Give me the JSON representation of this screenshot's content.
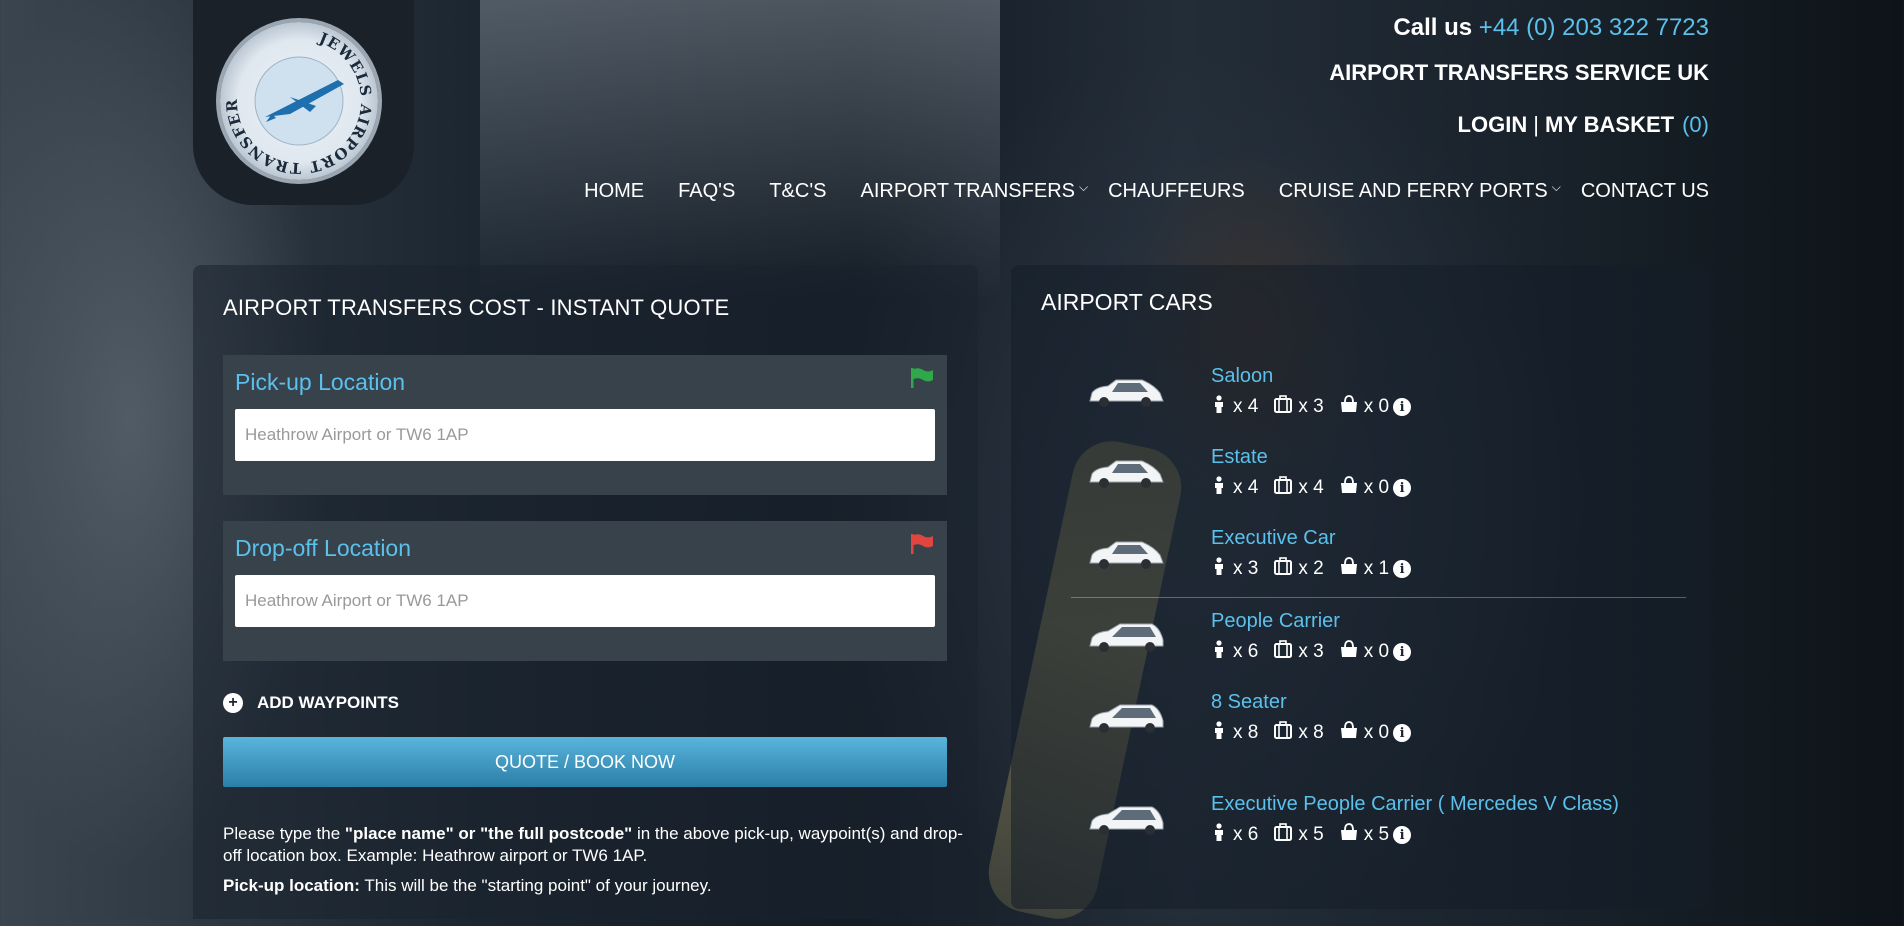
{
  "header": {
    "call_label": "Call us",
    "phone": "+44 (0) 203 322 7723",
    "brand": "AIRPORT TRANSFERS SERVICE UK",
    "login": "LOGIN",
    "separator": "|",
    "basket": "MY BASKET",
    "basket_count": "(0)",
    "logo_text": "JEWELS AIRPORT TRANSFERS"
  },
  "nav": [
    {
      "label": "HOME",
      "has_dropdown": false
    },
    {
      "label": "FAQ'S",
      "has_dropdown": false
    },
    {
      "label": "T&C'S",
      "has_dropdown": false
    },
    {
      "label": "AIRPORT TRANSFERS",
      "has_dropdown": true
    },
    {
      "label": "CHAUFFEURS",
      "has_dropdown": false
    },
    {
      "label": "CRUISE AND FERRY PORTS",
      "has_dropdown": true
    },
    {
      "label": "CONTACT US",
      "has_dropdown": false
    }
  ],
  "quote": {
    "title": "AIRPORT TRANSFERS COST - INSTANT QUOTE",
    "pickup_label": "Pick-up Location",
    "pickup_placeholder": "Heathrow Airport or TW6 1AP",
    "dropoff_label": "Drop-off Location",
    "dropoff_placeholder": "Heathrow Airport or TW6 1AP",
    "waypoints": "ADD WAYPOINTS",
    "button": "QUOTE / BOOK NOW",
    "help_prefix": "Please type the ",
    "help_bold": "\"place name\" or \"the full postcode\"",
    "help_suffix": " in the above pick-up, waypoint(s) and drop-off location box. Example: Heathrow airport or TW6 1AP.",
    "pickup_help_bold": "Pick-up location:",
    "pickup_help": " This will be the \"starting point\" of your journey.",
    "colors": {
      "pickup_flag": "#2ea84a",
      "dropoff_flag": "#e0453f",
      "accent": "#5bc0eb"
    }
  },
  "cars": {
    "title": "AIRPORT CARS",
    "items": [
      {
        "name": "Saloon",
        "passengers": "x 4",
        "large_bags": "x 3",
        "small_bags": "x 0"
      },
      {
        "name": "Estate",
        "passengers": "x 4",
        "large_bags": "x 4",
        "small_bags": "x 0"
      },
      {
        "name": "Executive Car",
        "passengers": "x 3",
        "large_bags": "x 2",
        "small_bags": "x 1"
      },
      {
        "name": "People Carrier",
        "passengers": "x 6",
        "large_bags": "x 3",
        "small_bags": "x 0"
      },
      {
        "name": "8 Seater",
        "passengers": "x 8",
        "large_bags": "x 8",
        "small_bags": "x 0"
      },
      {
        "name": "Executive People Carrier ( Mercedes V Class)",
        "passengers": "x 6",
        "large_bags": "x 5",
        "small_bags": "x 5"
      }
    ],
    "icons": {
      "passenger": "person-icon",
      "large_bag": "suitcase-icon",
      "small_bag": "bag-icon",
      "info": "info-icon"
    }
  }
}
